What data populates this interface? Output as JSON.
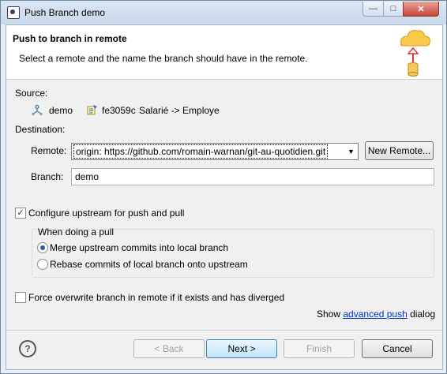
{
  "window": {
    "title": "Push Branch demo"
  },
  "banner": {
    "title": "Push to branch in remote",
    "description": "Select a remote and the name the branch should have in the remote."
  },
  "source": {
    "label": "Source:",
    "branch": "demo",
    "commit_id": "fe3059c",
    "commit_message": "Salarié -> Employe"
  },
  "destination": {
    "label": "Destination:",
    "remote_label": "Remote:",
    "remote_value": "origin: https://github.com/romain-warnan/git-au-quotidien.git",
    "new_remote_button": "New Remote...",
    "branch_label": "Branch:",
    "branch_value": "demo"
  },
  "upstream": {
    "checkbox_label": "Configure upstream for push and pull",
    "checked": true,
    "group_label": "When doing a pull",
    "options": [
      {
        "label": "Merge upstream commits into local branch",
        "selected": true
      },
      {
        "label": "Rebase commits of local branch onto upstream",
        "selected": false
      }
    ]
  },
  "force": {
    "label": "Force overwrite branch in remote if it exists and has diverged",
    "checked": false
  },
  "advanced": {
    "prefix": "Show",
    "link": "advanced push",
    "suffix": "dialog"
  },
  "buttons": {
    "back": "< Back",
    "next": "Next >",
    "finish": "Finish",
    "cancel": "Cancel"
  },
  "colors": {
    "link": "#0033cc",
    "default_button": "#c2e4f6"
  }
}
